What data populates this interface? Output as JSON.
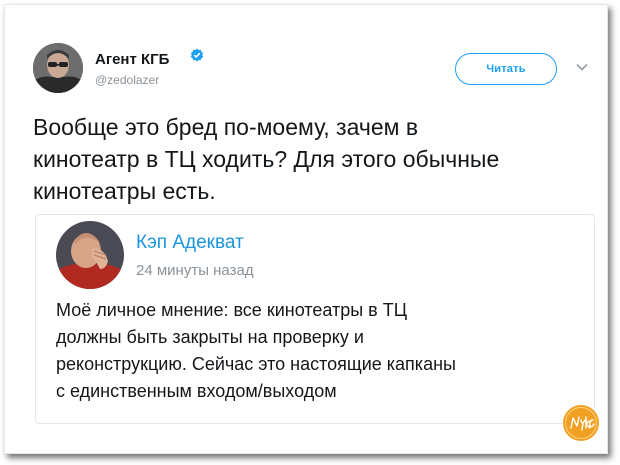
{
  "tweet": {
    "author_name": "Агент КГБ",
    "author_handle": "@zedolazer",
    "follow_label": "Читать",
    "text": "Вообще это бред по-моему, зачем в\nкинотеатр в ТЦ ходить? Для этого обычные\nкинотеатры есть."
  },
  "quoted": {
    "author_name": "Кэп Адекват",
    "time": "24 минуты назад",
    "text": "Моё личное мнение: все кинотеатры в ТЦ\nдолжны быть закрыты на проверку и\nреконструкцию. Сейчас это настоящие капканы\nс единственным входом/выходом"
  },
  "watermark": {
    "text": "Nyka"
  },
  "colors": {
    "accent": "#1da1f2",
    "link": "#1b95e0",
    "text": "#14171a",
    "muted": "#8a9299",
    "watermark": "#f2a024"
  },
  "icons": {
    "verified": "verified-badge-icon",
    "more": "chevron-down-icon"
  }
}
